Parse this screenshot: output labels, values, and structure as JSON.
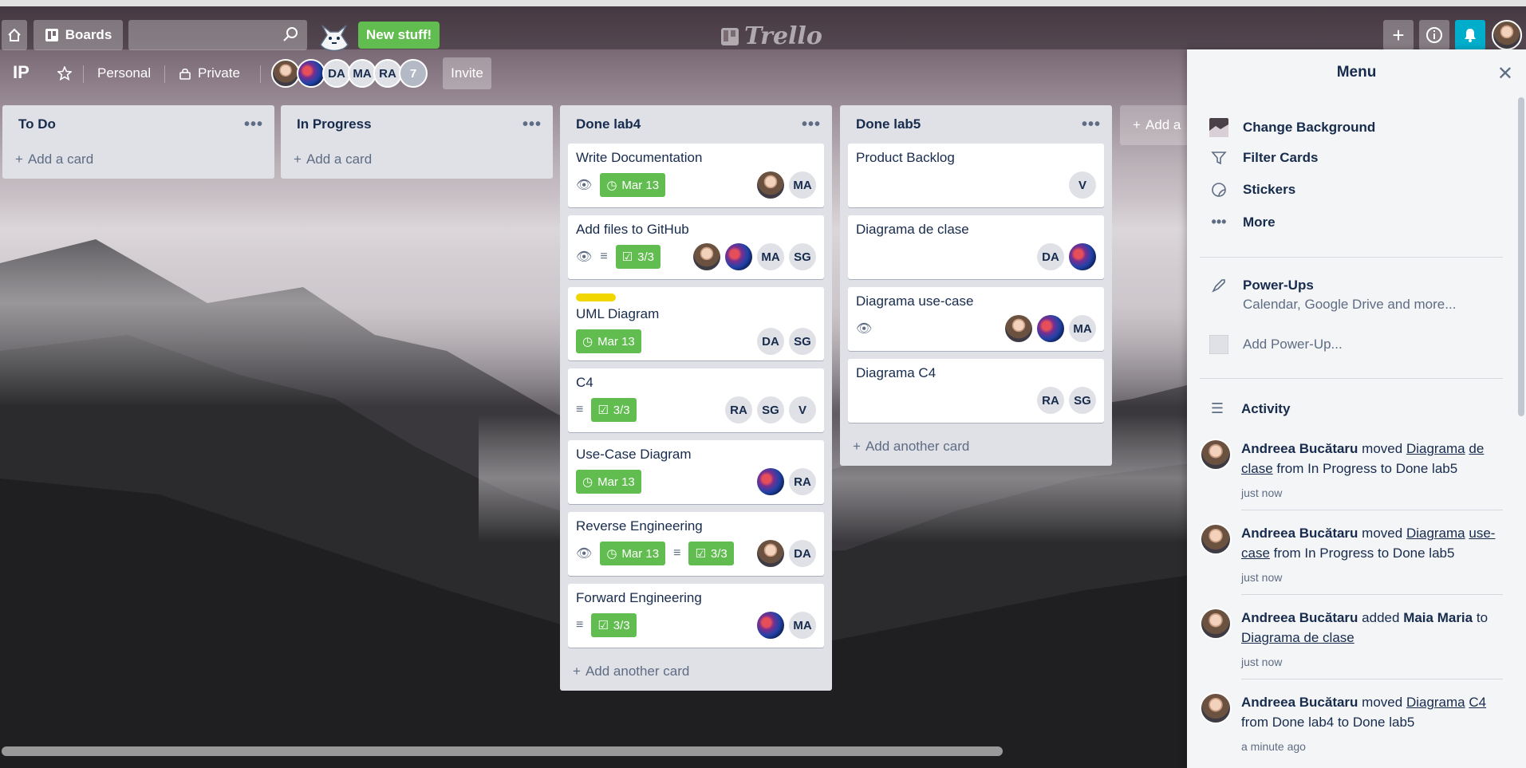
{
  "header": {
    "boards_label": "Boards",
    "search_placeholder": "",
    "new_stuff_label": "New stuff!",
    "logo_text": "Trello"
  },
  "board": {
    "title": "IP",
    "team_label": "Personal",
    "visibility_label": "Private",
    "members": [
      "DA",
      "MA",
      "RA"
    ],
    "extra_member_count": "7",
    "invite_label": "Invite"
  },
  "lists": [
    {
      "title": "To Do",
      "add_label": "Add a card",
      "cards": []
    },
    {
      "title": "In Progress",
      "add_label": "Add a card",
      "cards": []
    },
    {
      "title": "Done lab4",
      "add_label": "Add another card",
      "cards": [
        {
          "title": "Write Documentation",
          "due": "Mar 13",
          "members": [
            "MA"
          ]
        },
        {
          "title": "Add files to GitHub",
          "checklist": "3/3",
          "members": [
            "MA",
            "SG"
          ]
        },
        {
          "title": "UML Diagram",
          "due": "Mar 13",
          "members": [
            "DA",
            "SG"
          ]
        },
        {
          "title": "C4",
          "checklist": "3/3",
          "members": [
            "RA",
            "SG",
            "V"
          ]
        },
        {
          "title": "Use-Case Diagram",
          "due": "Mar 13",
          "members": [
            "RA"
          ]
        },
        {
          "title": "Reverse Engineering",
          "due": "Mar 13",
          "checklist": "3/3",
          "members": [
            "DA"
          ]
        },
        {
          "title": "Forward Engineering",
          "checklist": "3/3",
          "members": [
            "MA"
          ]
        }
      ]
    },
    {
      "title": "Done lab5",
      "add_label": "Add another card",
      "cards": [
        {
          "title": "Product Backlog",
          "members": [
            "V"
          ]
        },
        {
          "title": "Diagrama de clase",
          "members": [
            "DA"
          ]
        },
        {
          "title": "Diagrama use-case",
          "members": [
            "MA"
          ]
        },
        {
          "title": "Diagrama C4",
          "members": [
            "RA",
            "SG"
          ]
        }
      ]
    }
  ],
  "add_list_label": "Add a",
  "menu": {
    "title": "Menu",
    "items": [
      "Change Background",
      "Filter Cards",
      "Stickers",
      "More"
    ],
    "powerups_title": "Power-Ups",
    "powerups_sub": "Calendar, Google Drive and more...",
    "add_powerup": "Add Power-Up...",
    "activity_title": "Activity",
    "activity": [
      {
        "user": "Andreea Bucătaru",
        "verb": "moved",
        "card_a": "Diagrama",
        "card_b": "de clase",
        "rest": "from In Progress to Done lab5",
        "time": "just now"
      },
      {
        "user": "Andreea Bucătaru",
        "verb": "moved",
        "card_a": "Diagrama",
        "card_b": "use-case",
        "rest": "from In Progress to Done lab5",
        "time": "just now"
      },
      {
        "user": "Andreea Bucătaru",
        "verb": "added",
        "target": "Maia Maria",
        "to": "to",
        "card": "Diagrama de clase",
        "time": "just now"
      },
      {
        "user": "Andreea Bucătaru",
        "verb": "moved",
        "card_a": "Diagrama",
        "card_b": "C4",
        "rest": "from Done lab4 to Done lab5",
        "time": "a minute ago"
      }
    ]
  },
  "colors": {
    "accent_green": "#61bd4f",
    "notification_blue": "#00aecc",
    "label_yellow": "#f2d600"
  }
}
